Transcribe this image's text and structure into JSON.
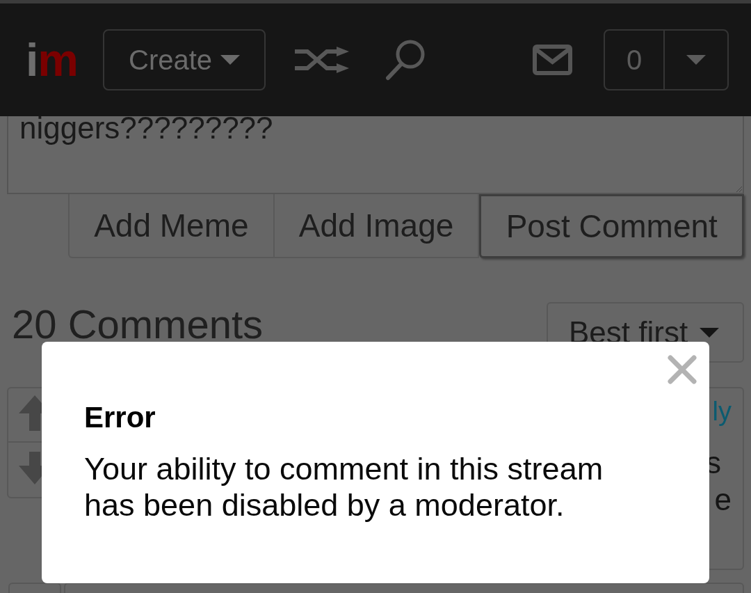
{
  "header": {
    "logo": [
      {
        "text": "i",
        "color": "#6e6e6e"
      },
      {
        "text": "m",
        "color": "#7a0000"
      }
    ],
    "create_button": {
      "label": "Create"
    },
    "notifications": {
      "count": "0"
    }
  },
  "comment_form": {
    "value": "niggers?????????",
    "buttons": [
      {
        "label": "Add Meme",
        "focused": false
      },
      {
        "label": "Add Image",
        "focused": false
      },
      {
        "label": "Post Comment",
        "focused": true
      }
    ]
  },
  "comments": {
    "heading": "20 Comments",
    "sort": {
      "label": "Best first"
    }
  },
  "comment": {
    "reply_link": "ly",
    "text": [
      "s",
      "e"
    ]
  },
  "dialog": {
    "title": "Error",
    "message": "Your ability to comment in this stream has been disabled by a moderator."
  }
}
